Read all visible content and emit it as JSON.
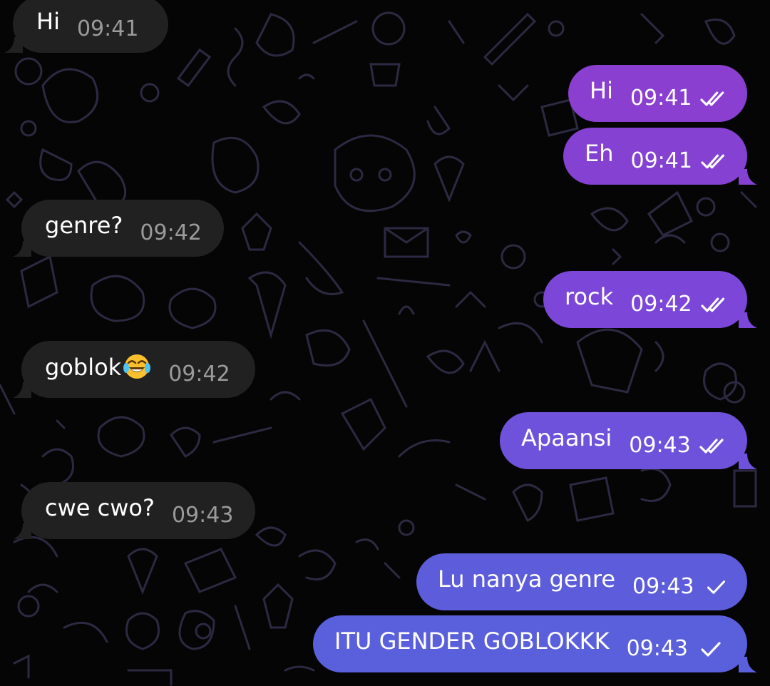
{
  "messages": [
    {
      "direction": "incoming",
      "text": "Hi",
      "time": "09:41"
    },
    {
      "direction": "outgoing",
      "text": "Hi",
      "time": "09:41",
      "status": "read",
      "color": "#8a3fd0"
    },
    {
      "direction": "outgoing",
      "text": "Eh",
      "time": "09:41",
      "status": "read",
      "color": "#8541d2"
    },
    {
      "direction": "incoming",
      "text": "genre?",
      "time": "09:42"
    },
    {
      "direction": "outgoing",
      "text": "rock",
      "time": "09:42",
      "status": "read",
      "color": "#7c47d8"
    },
    {
      "direction": "incoming",
      "text": "goblok",
      "emoji": "face-with-tears-of-joy-icon",
      "time": "09:42"
    },
    {
      "direction": "outgoing",
      "text": "Apaansi",
      "time": "09:43",
      "status": "read",
      "color": "#6f52db"
    },
    {
      "direction": "incoming",
      "text": "cwe cwo?",
      "time": "09:43"
    },
    {
      "direction": "outgoing",
      "text": "Lu nanya genre",
      "time": "09:43",
      "status": "delivered",
      "color": "#5d5ddb"
    },
    {
      "direction": "outgoing",
      "text": "ITU GENDER GOBLOKKK",
      "time": "09:43",
      "status": "delivered",
      "color": "#5a60db"
    }
  ],
  "theme": {
    "incoming_bubble": "#212121",
    "background": "#050505",
    "doodle_stroke": "#2e2a45"
  }
}
